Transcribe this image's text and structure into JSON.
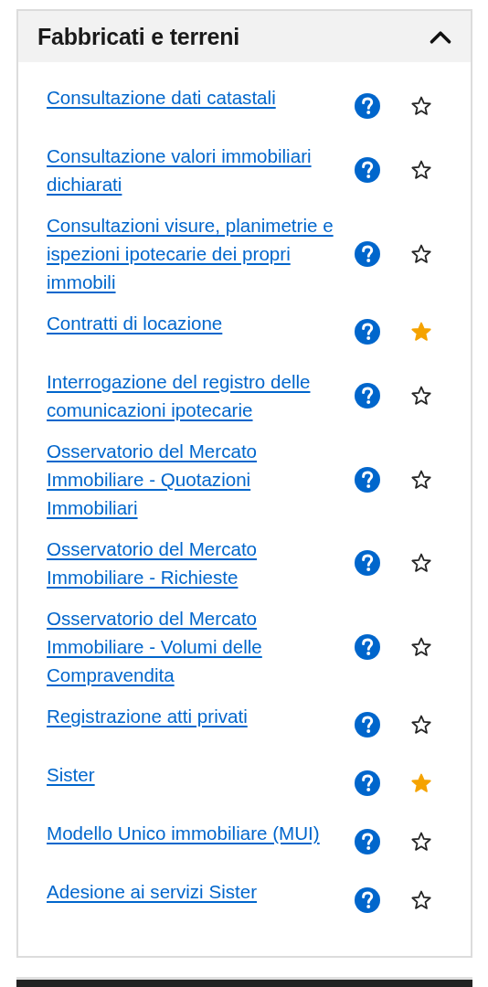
{
  "panel": {
    "title": "Fabbricati e terreni",
    "expanded": true,
    "items": [
      {
        "label": "Consultazione dati catastali",
        "favorite": false
      },
      {
        "label": "Consultazione valori immobiliari dichiarati",
        "favorite": false
      },
      {
        "label": "Consultazioni visure, planimetrie e ispezioni ipotecarie dei propri immobili",
        "favorite": false
      },
      {
        "label": "Contratti di locazione",
        "favorite": true
      },
      {
        "label": "Interrogazione del registro delle comunicazioni ipotecarie",
        "favorite": false
      },
      {
        "label": "Osservatorio del Mercato Immobiliare - Quotazioni Immobiliari",
        "favorite": false
      },
      {
        "label": "Osservatorio del Mercato Immobiliare - Richieste",
        "favorite": false
      },
      {
        "label": "Osservatorio del Mercato Immobiliare - Volumi delle Compravendita",
        "favorite": false
      },
      {
        "label": "Registrazione atti privati",
        "favorite": false
      },
      {
        "label": "Sister",
        "favorite": true
      },
      {
        "label": "Modello Unico immobiliare (MUI)",
        "favorite": false
      },
      {
        "label": "Adesione ai servizi Sister",
        "favorite": false
      }
    ]
  }
}
